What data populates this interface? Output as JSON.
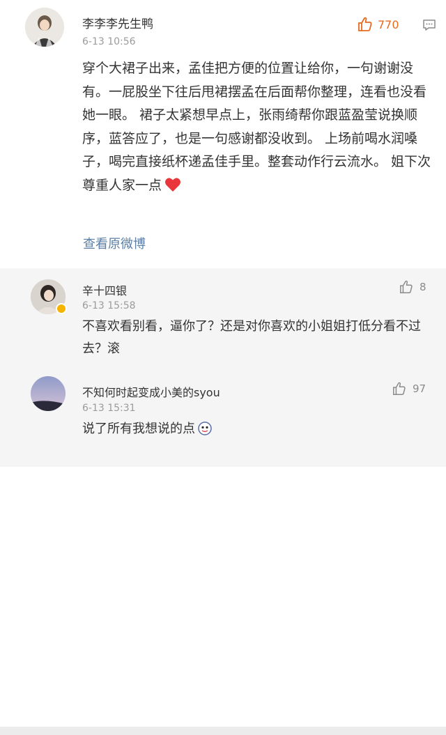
{
  "main_comment": {
    "username": "李李李先生鸭",
    "timestamp": "6-13 10:56",
    "like_count": "770",
    "text": "穿个大裙子出来，孟佳把方便的位置让给你，一句谢谢没有。一屁股坐下往后甩裙摆孟在后面帮你整理，连看也没看她一眼。 裙子太紧想早点上，张雨绮帮你跟蓝盈莹说换顺序，蓝答应了，也是一句感谢都没收到。 上场前喝水润嗓子，喝完直接纸杯递孟佳手里。整套动作行云流水。 姐下次尊重人家一点",
    "view_link": "查看原微博",
    "icons": [
      "thumbs-up-icon",
      "comment-icon",
      "heart-emoji"
    ],
    "accent_color": "#e86a1e"
  },
  "replies": [
    {
      "username": "辛十四银",
      "timestamp": "6-13 15:58",
      "like_count": "8",
      "text": "不喜欢看别看，逼你了？还是对你喜欢的小姐姐打低分看不过去？滚",
      "verified": true
    },
    {
      "username": "不知何时起变成小美的syou",
      "timestamp": "6-13 15:31",
      "like_count": "97",
      "text": "说了所有我想说的点",
      "emoji": "sticker-emoji"
    }
  ],
  "colors": {
    "link": "#5b7fa6",
    "muted": "#9b9b9b",
    "reply_background": "#f5f5f5"
  }
}
